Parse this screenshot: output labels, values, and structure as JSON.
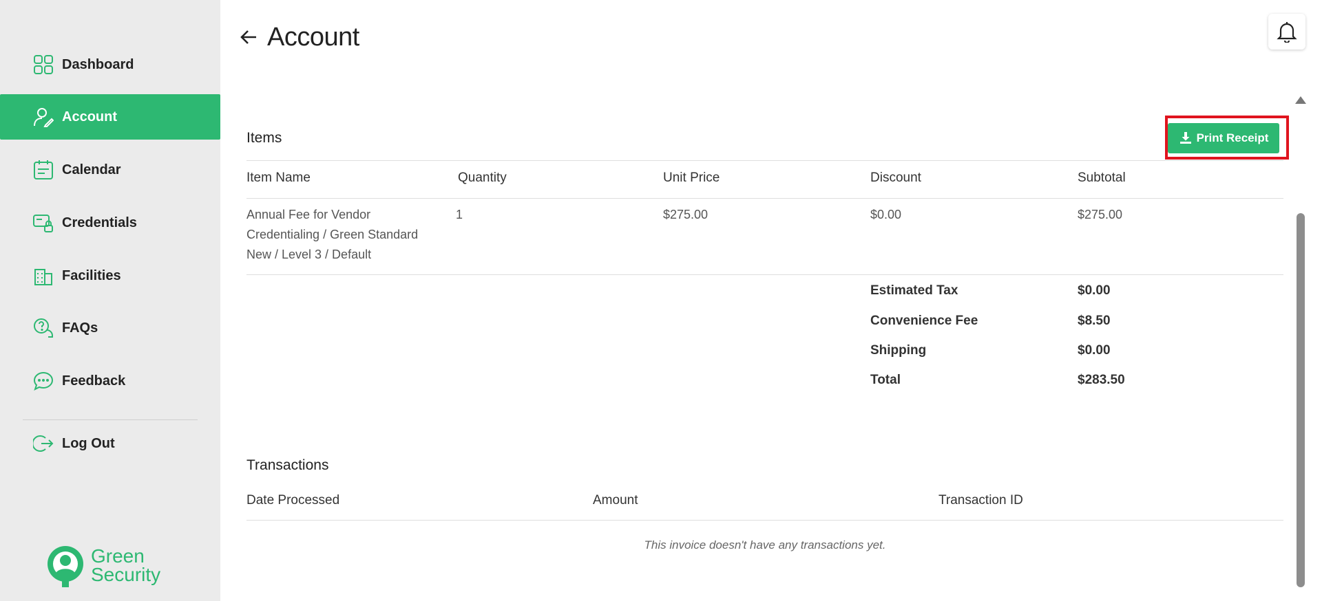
{
  "sidebar": {
    "items": [
      {
        "label": "Dashboard",
        "icon": "grid-icon"
      },
      {
        "label": "Account",
        "icon": "user-edit-icon"
      },
      {
        "label": "Calendar",
        "icon": "calendar-icon"
      },
      {
        "label": "Credentials",
        "icon": "credential-card-icon"
      },
      {
        "label": "Facilities",
        "icon": "building-icon"
      },
      {
        "label": "FAQs",
        "icon": "question-bubble-icon"
      },
      {
        "label": "Feedback",
        "icon": "chat-bubble-icon"
      }
    ],
    "logout": "Log Out",
    "logo": {
      "line1": "Green",
      "line2": "Security"
    },
    "accent": "#2db872"
  },
  "header": {
    "title": "Account"
  },
  "items_section": {
    "title": "Items",
    "print_button": "Print Receipt",
    "columns": [
      "Item Name",
      "Quantity",
      "Unit Price",
      "Discount",
      "Subtotal"
    ],
    "rows": [
      {
        "item_name_lines": [
          "Annual Fee for Vendor",
          "Credentialing / Green Standard",
          "New / Level 3 / Default"
        ],
        "quantity": "1",
        "unit_price": "$275.00",
        "discount": "$0.00",
        "subtotal": "$275.00"
      }
    ],
    "summary": [
      {
        "label": "Estimated Tax",
        "value": "$0.00"
      },
      {
        "label": "Convenience Fee",
        "value": "$8.50"
      },
      {
        "label": "Shipping",
        "value": "$0.00"
      },
      {
        "label": "Total",
        "value": "$283.50"
      }
    ]
  },
  "transactions_section": {
    "title": "Transactions",
    "columns": [
      "Date Processed",
      "Amount",
      "Transaction ID"
    ],
    "empty_message": "This invoice doesn't have any transactions yet."
  }
}
